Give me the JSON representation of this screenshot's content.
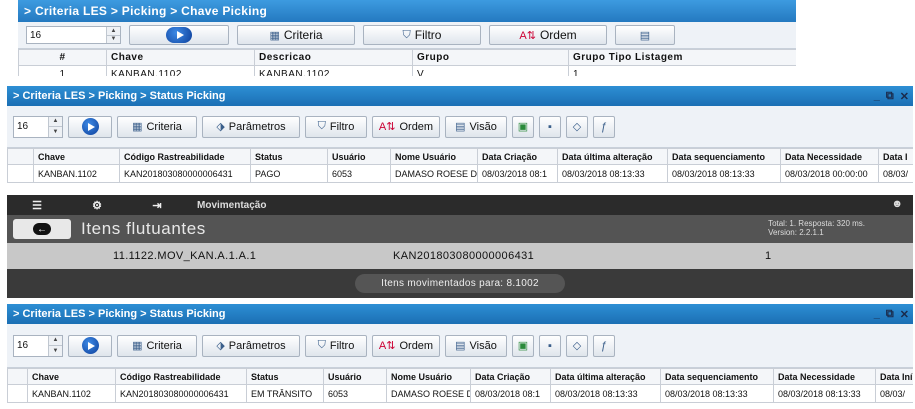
{
  "panel1": {
    "title": "> Criteria LES > Picking > Chave Picking",
    "stepper_value": "16",
    "buttons": {
      "criteria": "Criteria",
      "filtro": "Filtro",
      "ordem": "Ordem"
    },
    "columns": [
      "#",
      "Chave",
      "Descricao",
      "Grupo",
      "Grupo Tipo Listagem"
    ],
    "rows": [
      [
        "1",
        "KANBAN.1102",
        "KANBAN.1102",
        "V",
        "1"
      ]
    ]
  },
  "panel2": {
    "title": "> Criteria LES > Picking > Status Picking",
    "stepper_value": "16",
    "buttons": {
      "criteria": "Criteria",
      "parametros": "Parâmetros",
      "filtro": "Filtro",
      "ordem": "Ordem",
      "visao": "Visão"
    },
    "columns": [
      "Chave",
      "Código Rastreabilidade",
      "Status",
      "Usuário",
      "Nome Usuário",
      "Data Criação",
      "Data última alteração",
      "Data sequenciamento",
      "Data Necessidade",
      "Data I"
    ],
    "rows": [
      [
        "KANBAN.1102",
        "KAN201803080000006431",
        "PAGO",
        "6053",
        "DAMASO ROESE D",
        "08/03/2018 08:1",
        "08/03/2018 08:13:33",
        "08/03/2018 08:13:33",
        "08/03/2018 00:00:00",
        "08/03/"
      ]
    ]
  },
  "mobile": {
    "section": "Movimentação",
    "title": "Itens flutuantes",
    "total_line": "Total: 1. Resposta: 320 ms.",
    "version_line": "Version: 2.2.1.1",
    "row": {
      "address": "11.1122.MOV_KAN.A.1.A.1",
      "code": "KAN201803080000006431",
      "qty": "1"
    },
    "toast": "Itens movimentados para: 8.1002"
  },
  "panel3": {
    "title": "> Criteria LES > Picking > Status Picking",
    "stepper_value": "16",
    "buttons": {
      "criteria": "Criteria",
      "parametros": "Parâmetros",
      "filtro": "Filtro",
      "ordem": "Ordem",
      "visao": "Visão"
    },
    "columns": [
      "Chave",
      "Código Rastreabilidade",
      "Status",
      "Usuário",
      "Nome Usuário",
      "Data Criação",
      "Data última alteração",
      "Data sequenciamento",
      "Data Necessidade",
      "Data Iní"
    ],
    "rows": [
      [
        "KANBAN.1102",
        "KAN201803080000006431",
        "EM TRÂNSITO",
        "6053",
        "DAMASO ROESE D",
        "08/03/2018 08:1",
        "08/03/2018 08:13:33",
        "08/03/2018 08:13:33",
        "08/03/2018 08:13:33",
        "08/03/"
      ]
    ]
  }
}
